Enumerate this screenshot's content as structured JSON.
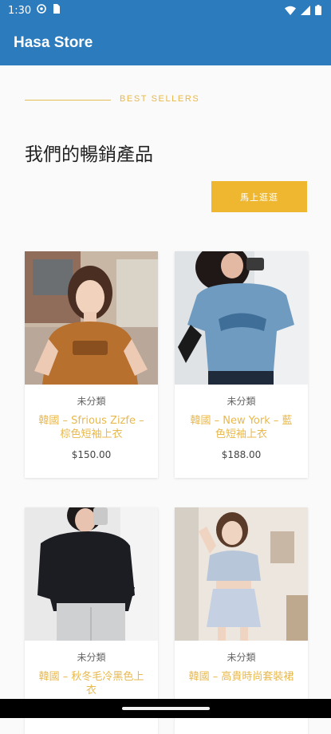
{
  "status": {
    "time": "1:30",
    "icons": [
      "gear-notification-icon",
      "sim-icon",
      "wifi-icon",
      "signal-icon",
      "battery-icon"
    ]
  },
  "appbar": {
    "title": "Hasa Store"
  },
  "section": {
    "label": "BEST SELLERS",
    "headline": "我們的暢銷產品",
    "button_label": "馬上逛逛"
  },
  "products": [
    {
      "category": "未分類",
      "title": "韓國 – Sfrious Zizfe – 棕色短袖上衣",
      "price": "$150.00",
      "image": "brown-tshirt-photo"
    },
    {
      "category": "未分類",
      "title": "韓國 – New York – 藍色短袖上衣",
      "price": "$188.00",
      "image": "blue-tshirt-photo"
    },
    {
      "category": "未分類",
      "title": "韓國 – 秋冬毛冷黑色上衣",
      "price": "",
      "image": "black-knit-sweater-photo"
    },
    {
      "category": "未分類",
      "title": "韓國 – 高貴時尚套裝裙",
      "price": "",
      "image": "light-blue-set-photo"
    }
  ],
  "colors": {
    "primary": "#2b7bbd",
    "accent": "#efb72f",
    "accent_text": "#e8b84a"
  }
}
